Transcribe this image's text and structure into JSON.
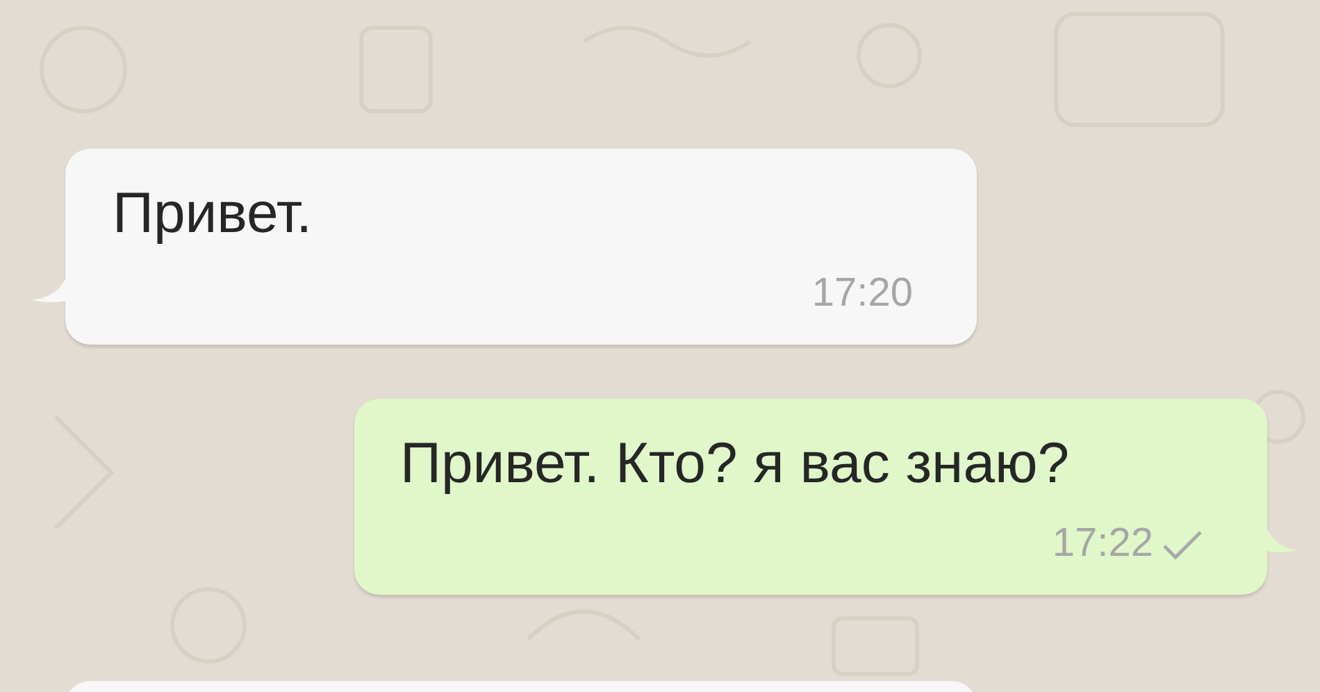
{
  "messages": [
    {
      "kind": "incoming",
      "text": "Привет.",
      "time": "17:20"
    },
    {
      "kind": "outgoing",
      "text": "Привет. Кто? я вас знаю?",
      "time": "17:22",
      "sent": true
    },
    {
      "kind": "incoming"
    }
  ]
}
